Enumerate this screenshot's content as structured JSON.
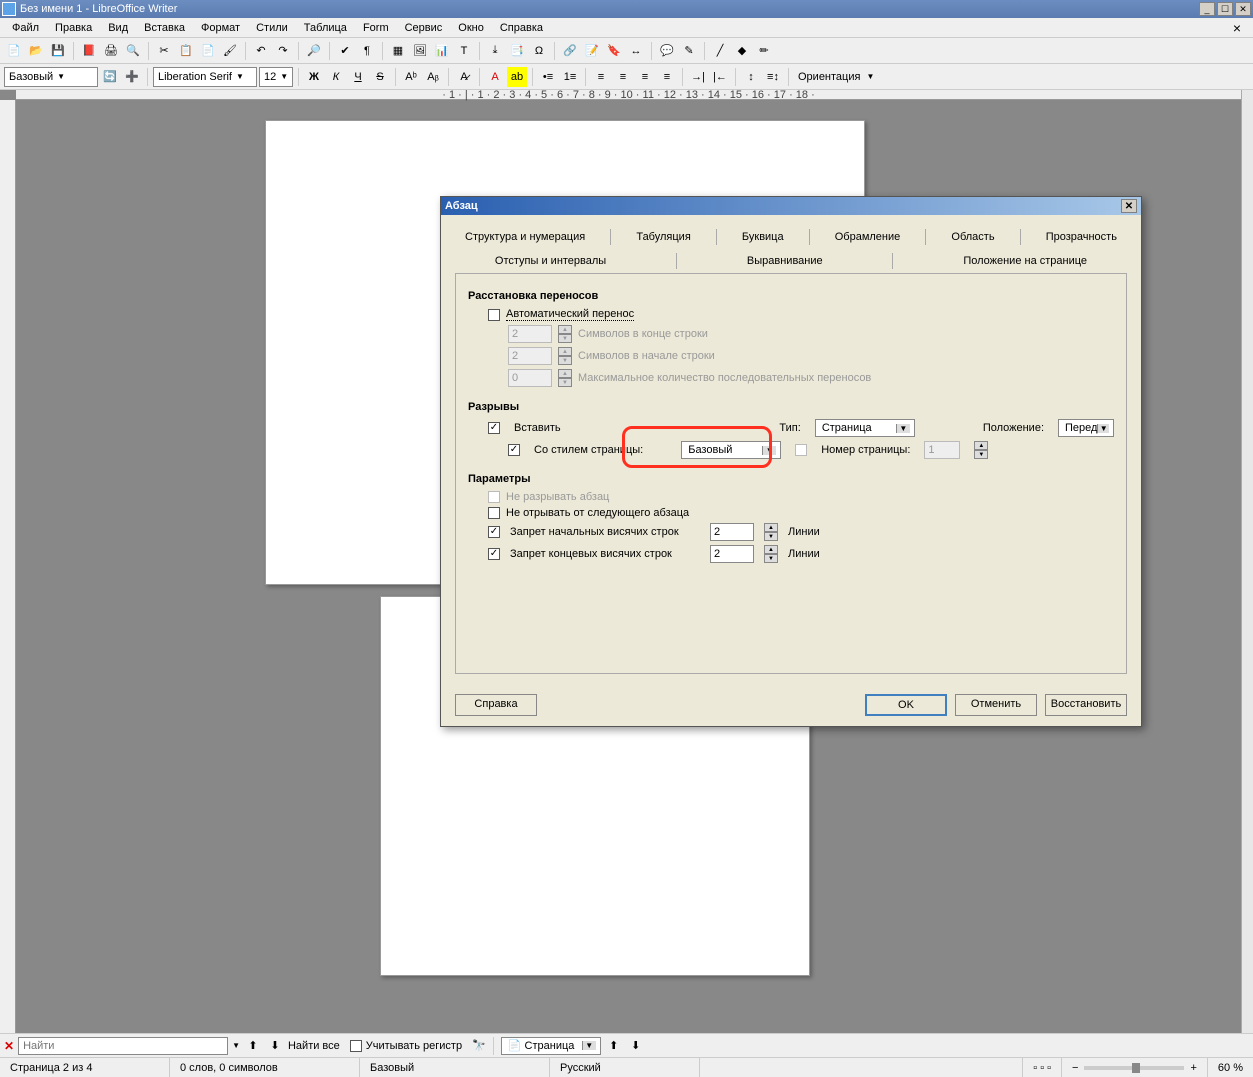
{
  "title": "Без имени 1 - LibreOffice Writer",
  "menu": [
    "Файл",
    "Правка",
    "Вид",
    "Вставка",
    "Формат",
    "Стили",
    "Таблица",
    "Form",
    "Сервис",
    "Окно",
    "Справка"
  ],
  "toolbar2": {
    "style": "Базовый",
    "font": "Liberation Serif",
    "size": "12",
    "orientation": "Ориентация"
  },
  "ruler": "· 1 · | · 1 · 2 · 3 · 4 · 5 · 6 · 7 · 8 · 9 · 10 · 11 · 12 · 13 · 14 · 15 · 16 · 17 · 18 ·",
  "dialog": {
    "title": "Абзац",
    "tabs_row1": [
      "Структура и нумерация",
      "Табуляция",
      "Буквица",
      "Обрамление",
      "Область",
      "Прозрачность"
    ],
    "tabs_row2": [
      "Отступы и интервалы",
      "Выравнивание",
      "Положение на странице"
    ],
    "hyphenation": {
      "heading": "Расстановка переносов",
      "auto": "Автоматический перенос",
      "end_val": "2",
      "end_lbl": "Символов в конце строки",
      "start_val": "2",
      "start_lbl": "Символов в начале строки",
      "max_val": "0",
      "max_lbl": "Максимальное количество последовательных переносов"
    },
    "breaks": {
      "heading": "Разрывы",
      "insert": "Вставить",
      "type_lbl": "Тип:",
      "type_val": "Страница",
      "pos_lbl": "Положение:",
      "pos_val": "Перед",
      "with_style": "Со стилем страницы:",
      "style_val": "Базовый",
      "pagenum_lbl": "Номер страницы:",
      "pagenum_val": "1"
    },
    "options": {
      "heading": "Параметры",
      "no_split": "Не разрывать абзац",
      "keep_next": "Не отрывать от следующего абзаца",
      "orphan": "Запрет начальных висячих строк",
      "orphan_val": "2",
      "orphan_unit": "Линии",
      "widow": "Запрет концевых висячих строк",
      "widow_val": "2",
      "widow_unit": "Линии"
    },
    "buttons": {
      "help": "Справка",
      "ok": "OK",
      "cancel": "Отменить",
      "reset": "Восстановить"
    }
  },
  "findbar": {
    "placeholder": "Найти",
    "find_all": "Найти все",
    "match_case": "Учитывать регистр",
    "nav_combo": "Страница"
  },
  "status": {
    "page": "Страница 2 из 4",
    "words": "0 слов, 0 символов",
    "style": "Базовый",
    "lang": "Русский",
    "zoom": "60 %"
  }
}
